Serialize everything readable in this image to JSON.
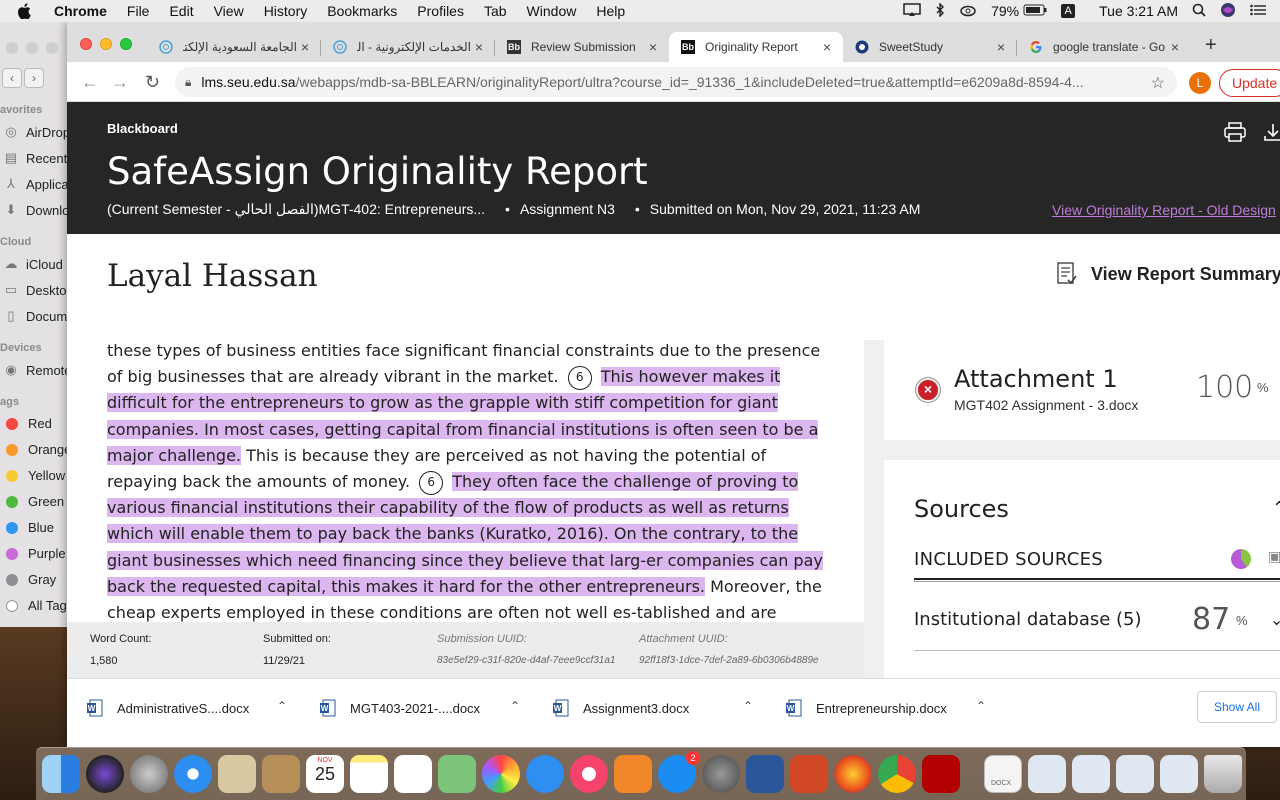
{
  "menubar": {
    "app": "Chrome",
    "items": [
      "File",
      "Edit",
      "View",
      "History",
      "Bookmarks",
      "Profiles",
      "Tab",
      "Window",
      "Help"
    ],
    "battery": "79%",
    "input_source": "A",
    "clock": "Tue 3:21 AM"
  },
  "finder": {
    "sections": [
      "avorites",
      "Cloud",
      "Devices",
      "ags"
    ],
    "favorites": [
      "AirDrop",
      "Recents",
      "Applications",
      "Downloads"
    ],
    "cloud": [
      "iCloud",
      "Desktop",
      "Documents"
    ],
    "devices": [
      "Remote"
    ],
    "tags": [
      {
        "label": "Red",
        "color": "#f4473e"
      },
      {
        "label": "Orange",
        "color": "#f79a27"
      },
      {
        "label": "Yellow",
        "color": "#f8c935"
      },
      {
        "label": "Green",
        "color": "#4cbb3c"
      },
      {
        "label": "Blue",
        "color": "#2f95ef"
      },
      {
        "label": "Purple",
        "color": "#c76ad8"
      },
      {
        "label": "Gray",
        "color": "#8e8e93"
      },
      {
        "label": "All Tags...",
        "color": "#e0e0e0"
      }
    ]
  },
  "tabs": [
    {
      "title": "الجامعة السعودية الإلكترونية",
      "icon": "globe-icon"
    },
    {
      "title": "الخدمات الإلكترونية - الجا",
      "icon": "globe-icon"
    },
    {
      "title": "Review Submission",
      "icon": "blackboard-icon"
    },
    {
      "title": "Originality Report",
      "icon": "blackboard-icon"
    },
    {
      "title": "SweetStudy",
      "icon": "sweetstudy-icon"
    },
    {
      "title": "google translate - Go",
      "icon": "google-icon"
    }
  ],
  "toolbar": {
    "url_host": "lms.seu.edu.sa",
    "url_path": "/webapps/mdb-sa-BBLEARN/originalityReport/ultra?course_id=_91336_1&includeDeleted=true&attemptId=e6209a8d-8594-4...",
    "profile_initial": "L",
    "update_label": "Update"
  },
  "report": {
    "brand": "Blackboard",
    "title": "SafeAssign Originality Report",
    "course": "(Current Semester - الفصل الحالي)MGT-402: Entrepreneurs...",
    "assignment": "Assignment N3",
    "submitted": "Submitted on Mon, Nov 29, 2021, 11:23 AM",
    "bullet": "•",
    "old_design_link": "View Originality Report - Old Design",
    "student_name": "Layal Hassan",
    "summary_label": "View Report Summary"
  },
  "document": {
    "t1": "these types of business entities face significant financial constraints due to the presence of big businesses that are already vibrant in the market.",
    "b1": "6",
    "h1": "This however makes it difficult for the entrepreneurs to grow as the grapple with stiff competition for giant companies. In most cases, getting capital from financial institutions is often seen to be a major challenge.",
    "t2": "This is because they are perceived as not having the potential of repaying back the amounts of money.",
    "b2": "6",
    "h2": "They often face the challenge of proving to various financial institutions their capability of the flow of products as well as returns which will enable them to pay back the banks (Kuratko, 2016). On the contrary, to the giant businesses which need financing since they believe that larg-er companies can pay back the requested capital, this makes it hard for the other entrepreneurs.",
    "t3": "Moreover, the cheap experts employed in these conditions are often not well es-tablished and are usually prone to many errors and mistakes which plunch such businesses at a"
  },
  "footer": {
    "word_count_label": "Word Count:",
    "word_count": "1,580",
    "submitted_label": "Submitted on:",
    "submitted_date": "11/29/21",
    "submission_uuid_label": "Submission UUID:",
    "submission_uuid": "83e5ef29-c31f-820e-d4af-7eee9ccf31a1",
    "attachment_uuid_label": "Attachment UUID:",
    "attachment_uuid": "92ff18f3-1dce-7def-2a89-6b0306b4889e"
  },
  "attachment": {
    "title": "Attachment 1",
    "file": "MGT402 Assignment - 3.docx",
    "percent": "100",
    "percent_sign": "%"
  },
  "sources": {
    "heading": "Sources",
    "included_label": "INCLUDED SOURCES",
    "db_label": "Institutional database (5)",
    "db_percent": "87",
    "percent_sign": "%"
  },
  "downloads": {
    "items": [
      "AdministrativeS....docx",
      "MGT403-2021-....docx",
      "Assignment3.docx",
      "Entrepreneurship.docx"
    ],
    "show_all": "Show All"
  },
  "dock": {
    "calendar_month": "NOV",
    "calendar_day": "25",
    "app_store_badge": "2",
    "preview_label": "DOCX"
  }
}
